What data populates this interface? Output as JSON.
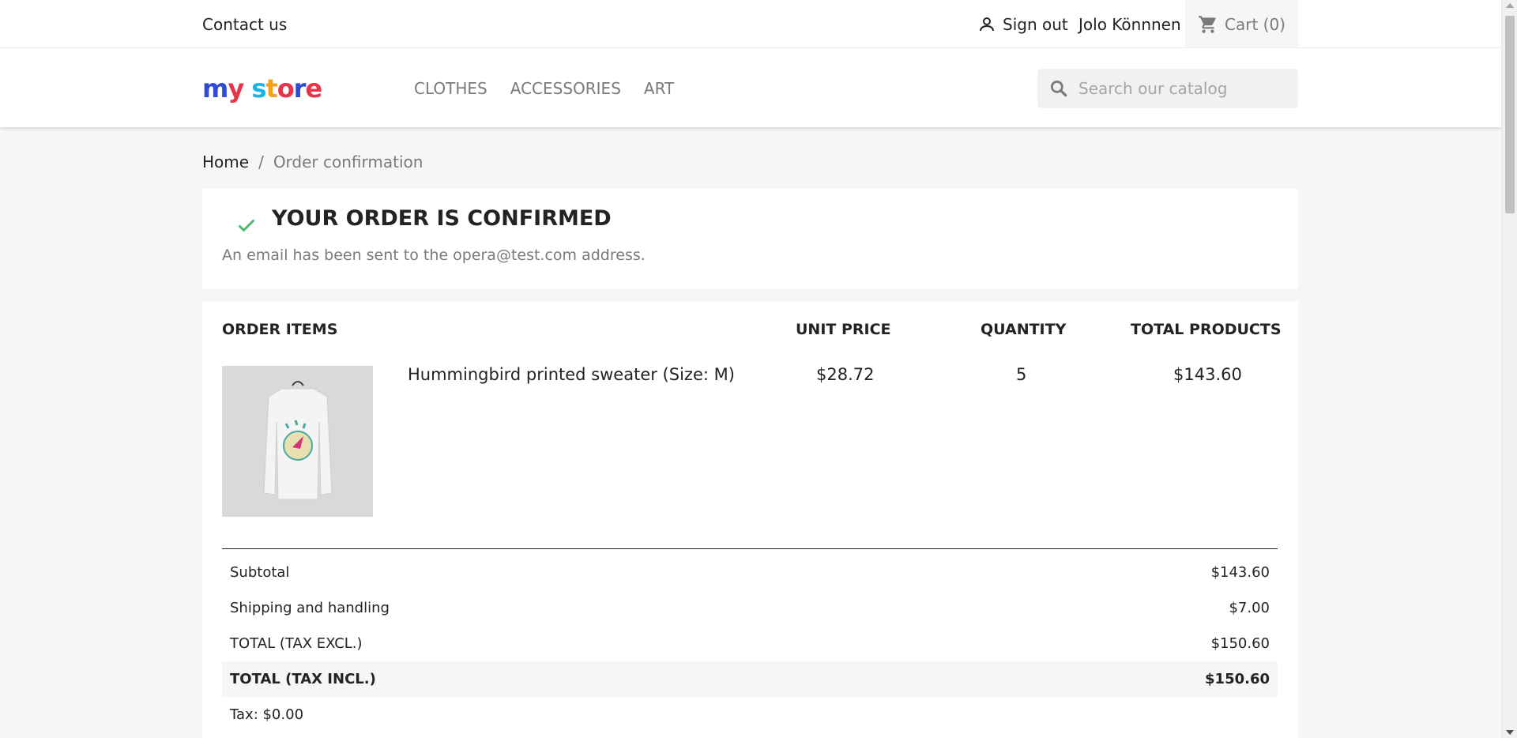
{
  "topbar": {
    "contact_label": "Contact us",
    "signout_label": "Sign out",
    "user_name": "Jolo Könnnen",
    "cart_label": "Cart (0)"
  },
  "header": {
    "logo_text": "my store",
    "menu": [
      "CLOTHES",
      "ACCESSORIES",
      "ART"
    ],
    "search_placeholder": "Search our catalog"
  },
  "breadcrumb": {
    "home": "Home",
    "separator": "/",
    "current": "Order confirmation"
  },
  "confirmation": {
    "title": "YOUR ORDER IS CONFIRMED",
    "message": "An email has been sent to the opera@test.com address."
  },
  "order": {
    "headers": {
      "items": "ORDER ITEMS",
      "unit_price": "UNIT PRICE",
      "quantity": "QUANTITY",
      "total": "TOTAL PRODUCTS"
    },
    "items": [
      {
        "name": "Hummingbird printed sweater (Size: M)",
        "unit_price": "$28.72",
        "quantity": "5",
        "total": "$143.60"
      }
    ],
    "totals": [
      {
        "label": "Subtotal",
        "value": "$143.60"
      },
      {
        "label": "Shipping and handling",
        "value": "$7.00"
      },
      {
        "label": "TOTAL (TAX EXCL.)",
        "value": "$150.60"
      },
      {
        "label": "TOTAL (TAX INCL.)",
        "value": "$150.60"
      },
      {
        "label": "Tax: $0.00",
        "value": ""
      }
    ]
  },
  "colors": {
    "accent_check": "#4cbb6c",
    "text": "#232323",
    "muted": "#7a7a7a"
  }
}
